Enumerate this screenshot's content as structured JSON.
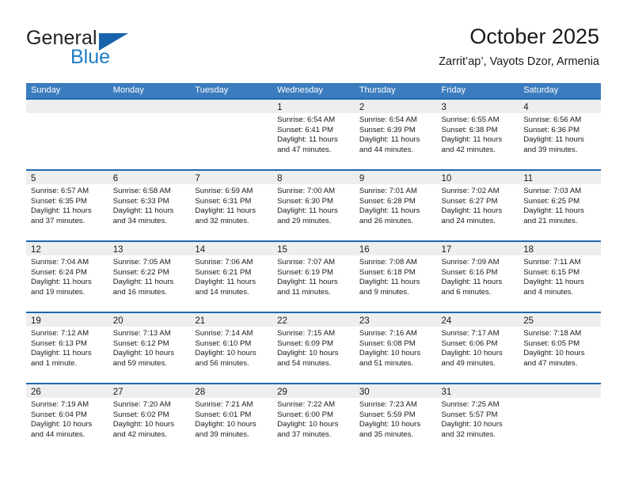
{
  "brand": {
    "word_general": "General",
    "word_blue": "Blue",
    "logo_icon": "triangle-flag-icon"
  },
  "header": {
    "title": "October 2025",
    "subtitle": "Zarrit’ap’, Vayots Dzor, Armenia"
  },
  "colors": {
    "header_band": "#3b7cbf",
    "row_divider": "#1f68b0",
    "day_strip": "#eeeeee",
    "brand_blue": "#1f7dc4",
    "text": "#1a1a1a"
  },
  "calendar": {
    "weekdays": [
      "Sunday",
      "Monday",
      "Tuesday",
      "Wednesday",
      "Thursday",
      "Friday",
      "Saturday"
    ],
    "weeks": [
      [
        {
          "day": "",
          "lines": []
        },
        {
          "day": "",
          "lines": []
        },
        {
          "day": "",
          "lines": []
        },
        {
          "day": "1",
          "lines": [
            "Sunrise: 6:54 AM",
            "Sunset: 6:41 PM",
            "Daylight: 11 hours",
            "and 47 minutes."
          ]
        },
        {
          "day": "2",
          "lines": [
            "Sunrise: 6:54 AM",
            "Sunset: 6:39 PM",
            "Daylight: 11 hours",
            "and 44 minutes."
          ]
        },
        {
          "day": "3",
          "lines": [
            "Sunrise: 6:55 AM",
            "Sunset: 6:38 PM",
            "Daylight: 11 hours",
            "and 42 minutes."
          ]
        },
        {
          "day": "4",
          "lines": [
            "Sunrise: 6:56 AM",
            "Sunset: 6:36 PM",
            "Daylight: 11 hours",
            "and 39 minutes."
          ]
        }
      ],
      [
        {
          "day": "5",
          "lines": [
            "Sunrise: 6:57 AM",
            "Sunset: 6:35 PM",
            "Daylight: 11 hours",
            "and 37 minutes."
          ]
        },
        {
          "day": "6",
          "lines": [
            "Sunrise: 6:58 AM",
            "Sunset: 6:33 PM",
            "Daylight: 11 hours",
            "and 34 minutes."
          ]
        },
        {
          "day": "7",
          "lines": [
            "Sunrise: 6:59 AM",
            "Sunset: 6:31 PM",
            "Daylight: 11 hours",
            "and 32 minutes."
          ]
        },
        {
          "day": "8",
          "lines": [
            "Sunrise: 7:00 AM",
            "Sunset: 6:30 PM",
            "Daylight: 11 hours",
            "and 29 minutes."
          ]
        },
        {
          "day": "9",
          "lines": [
            "Sunrise: 7:01 AM",
            "Sunset: 6:28 PM",
            "Daylight: 11 hours",
            "and 26 minutes."
          ]
        },
        {
          "day": "10",
          "lines": [
            "Sunrise: 7:02 AM",
            "Sunset: 6:27 PM",
            "Daylight: 11 hours",
            "and 24 minutes."
          ]
        },
        {
          "day": "11",
          "lines": [
            "Sunrise: 7:03 AM",
            "Sunset: 6:25 PM",
            "Daylight: 11 hours",
            "and 21 minutes."
          ]
        }
      ],
      [
        {
          "day": "12",
          "lines": [
            "Sunrise: 7:04 AM",
            "Sunset: 6:24 PM",
            "Daylight: 11 hours",
            "and 19 minutes."
          ]
        },
        {
          "day": "13",
          "lines": [
            "Sunrise: 7:05 AM",
            "Sunset: 6:22 PM",
            "Daylight: 11 hours",
            "and 16 minutes."
          ]
        },
        {
          "day": "14",
          "lines": [
            "Sunrise: 7:06 AM",
            "Sunset: 6:21 PM",
            "Daylight: 11 hours",
            "and 14 minutes."
          ]
        },
        {
          "day": "15",
          "lines": [
            "Sunrise: 7:07 AM",
            "Sunset: 6:19 PM",
            "Daylight: 11 hours",
            "and 11 minutes."
          ]
        },
        {
          "day": "16",
          "lines": [
            "Sunrise: 7:08 AM",
            "Sunset: 6:18 PM",
            "Daylight: 11 hours",
            "and 9 minutes."
          ]
        },
        {
          "day": "17",
          "lines": [
            "Sunrise: 7:09 AM",
            "Sunset: 6:16 PM",
            "Daylight: 11 hours",
            "and 6 minutes."
          ]
        },
        {
          "day": "18",
          "lines": [
            "Sunrise: 7:11 AM",
            "Sunset: 6:15 PM",
            "Daylight: 11 hours",
            "and 4 minutes."
          ]
        }
      ],
      [
        {
          "day": "19",
          "lines": [
            "Sunrise: 7:12 AM",
            "Sunset: 6:13 PM",
            "Daylight: 11 hours",
            "and 1 minute."
          ]
        },
        {
          "day": "20",
          "lines": [
            "Sunrise: 7:13 AM",
            "Sunset: 6:12 PM",
            "Daylight: 10 hours",
            "and 59 minutes."
          ]
        },
        {
          "day": "21",
          "lines": [
            "Sunrise: 7:14 AM",
            "Sunset: 6:10 PM",
            "Daylight: 10 hours",
            "and 56 minutes."
          ]
        },
        {
          "day": "22",
          "lines": [
            "Sunrise: 7:15 AM",
            "Sunset: 6:09 PM",
            "Daylight: 10 hours",
            "and 54 minutes."
          ]
        },
        {
          "day": "23",
          "lines": [
            "Sunrise: 7:16 AM",
            "Sunset: 6:08 PM",
            "Daylight: 10 hours",
            "and 51 minutes."
          ]
        },
        {
          "day": "24",
          "lines": [
            "Sunrise: 7:17 AM",
            "Sunset: 6:06 PM",
            "Daylight: 10 hours",
            "and 49 minutes."
          ]
        },
        {
          "day": "25",
          "lines": [
            "Sunrise: 7:18 AM",
            "Sunset: 6:05 PM",
            "Daylight: 10 hours",
            "and 47 minutes."
          ]
        }
      ],
      [
        {
          "day": "26",
          "lines": [
            "Sunrise: 7:19 AM",
            "Sunset: 6:04 PM",
            "Daylight: 10 hours",
            "and 44 minutes."
          ]
        },
        {
          "day": "27",
          "lines": [
            "Sunrise: 7:20 AM",
            "Sunset: 6:02 PM",
            "Daylight: 10 hours",
            "and 42 minutes."
          ]
        },
        {
          "day": "28",
          "lines": [
            "Sunrise: 7:21 AM",
            "Sunset: 6:01 PM",
            "Daylight: 10 hours",
            "and 39 minutes."
          ]
        },
        {
          "day": "29",
          "lines": [
            "Sunrise: 7:22 AM",
            "Sunset: 6:00 PM",
            "Daylight: 10 hours",
            "and 37 minutes."
          ]
        },
        {
          "day": "30",
          "lines": [
            "Sunrise: 7:23 AM",
            "Sunset: 5:59 PM",
            "Daylight: 10 hours",
            "and 35 minutes."
          ]
        },
        {
          "day": "31",
          "lines": [
            "Sunrise: 7:25 AM",
            "Sunset: 5:57 PM",
            "Daylight: 10 hours",
            "and 32 minutes."
          ]
        },
        {
          "day": "",
          "lines": []
        }
      ]
    ]
  }
}
